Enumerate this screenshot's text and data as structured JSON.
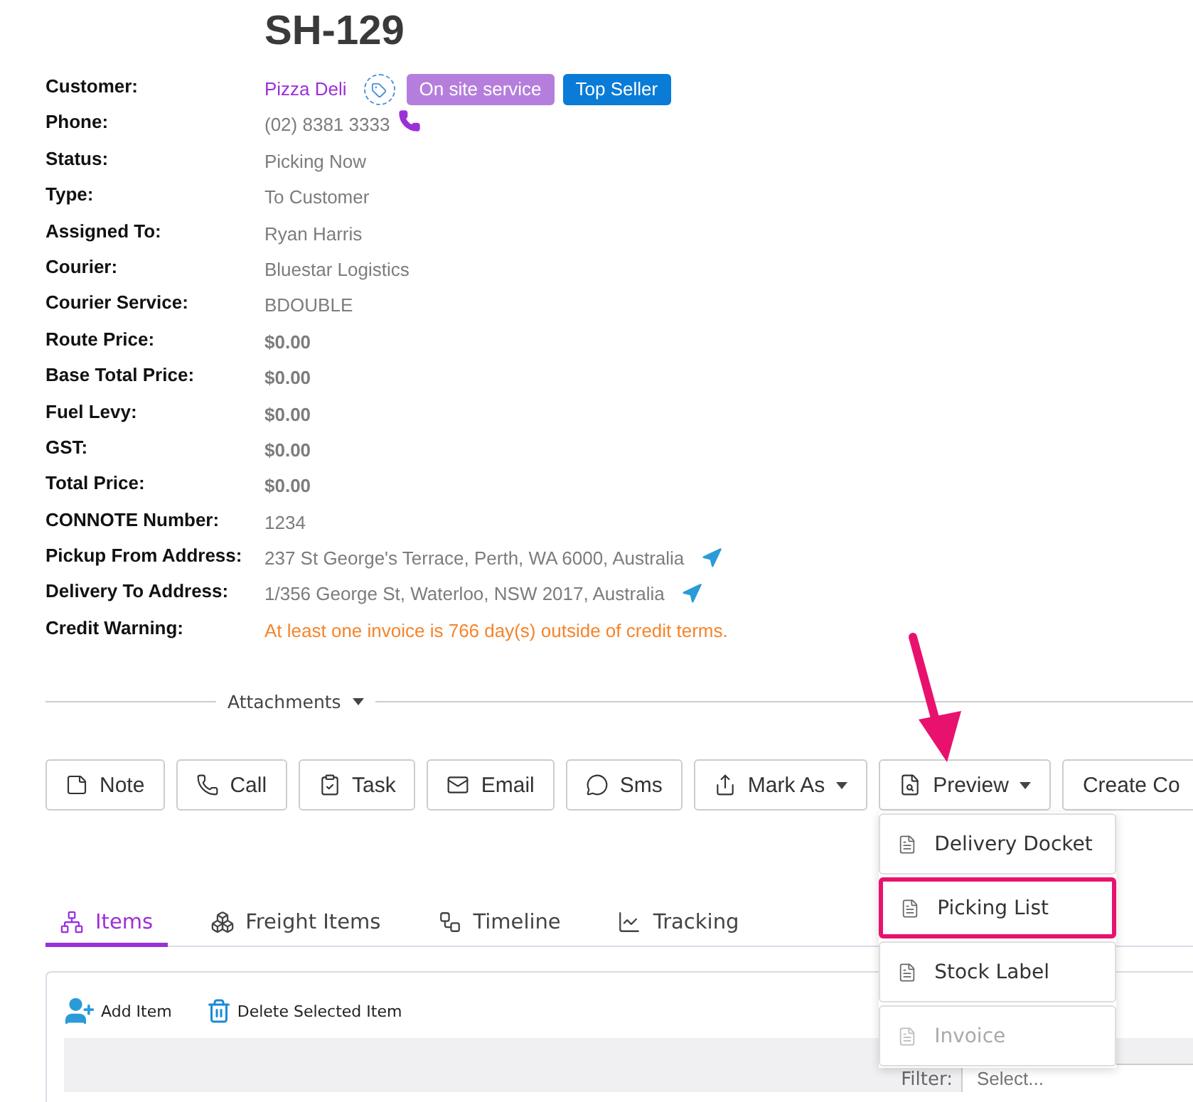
{
  "title": "SH-129",
  "fields": [
    {
      "label": "Customer:",
      "value": "Pizza Deli",
      "kind": "customer",
      "tags": [
        {
          "label": "On site service",
          "color": "#b57edc"
        },
        {
          "label": "Top Seller",
          "color": "#0a7bd6"
        }
      ]
    },
    {
      "label": "Phone:",
      "value": "(02) 8381 3333",
      "kind": "phone"
    },
    {
      "label": "Status:",
      "value": "Picking Now",
      "kind": "text"
    },
    {
      "label": "Type:",
      "value": "To Customer",
      "kind": "text"
    },
    {
      "label": "Assigned To:",
      "value": "Ryan Harris",
      "kind": "text"
    },
    {
      "label": "Courier:",
      "value": "Bluestar Logistics",
      "kind": "text"
    },
    {
      "label": "Courier Service:",
      "value": "BDOUBLE",
      "kind": "text"
    },
    {
      "label": "Route Price:",
      "value": "$0.00",
      "kind": "price"
    },
    {
      "label": "Base Total Price:",
      "value": "$0.00",
      "kind": "price"
    },
    {
      "label": "Fuel Levy:",
      "value": "$0.00",
      "kind": "price"
    },
    {
      "label": "GST:",
      "value": "$0.00",
      "kind": "price"
    },
    {
      "label": "Total Price:",
      "value": "$0.00",
      "kind": "price"
    },
    {
      "label": "CONNOTE Number:",
      "value": "1234",
      "kind": "text"
    },
    {
      "label": "Pickup From Address:",
      "value": "237 St George's Terrace, Perth, WA 6000, Australia",
      "kind": "address"
    },
    {
      "label": "Delivery To Address:",
      "value": "1/356 George St, Waterloo, NSW 2017, Australia",
      "kind": "address"
    },
    {
      "label": "Credit Warning:",
      "value": "At least one invoice is 766 day(s) outside of credit terms.",
      "kind": "warning"
    }
  ],
  "attachments": {
    "label": "Attachments"
  },
  "actions": [
    {
      "label": "Note",
      "kind": "note",
      "dropdown": false
    },
    {
      "label": "Call",
      "kind": "call",
      "dropdown": false
    },
    {
      "label": "Task",
      "kind": "task",
      "dropdown": false
    },
    {
      "label": "Email",
      "kind": "email",
      "dropdown": false
    },
    {
      "label": "Sms",
      "kind": "sms",
      "dropdown": false
    },
    {
      "label": "Mark As",
      "kind": "share",
      "dropdown": true
    },
    {
      "label": "Preview",
      "kind": "preview",
      "dropdown": true,
      "menu": [
        {
          "label": "Delivery Docket",
          "selected": false,
          "disabled": false
        },
        {
          "label": "Picking List",
          "selected": true,
          "disabled": false
        },
        {
          "label": "Stock Label",
          "selected": false,
          "disabled": false
        },
        {
          "label": "Invoice",
          "selected": false,
          "disabled": true
        }
      ]
    },
    {
      "label": "Create Co",
      "kind": "plain",
      "dropdown": false
    }
  ],
  "tabs": [
    {
      "label": "Items",
      "kind": "sitemap",
      "selected": true
    },
    {
      "label": "Freight Items",
      "kind": "boxes",
      "selected": false
    },
    {
      "label": "Timeline",
      "kind": "workflow",
      "selected": false
    },
    {
      "label": "Tracking",
      "kind": "chart",
      "selected": false
    }
  ],
  "toolbar": {
    "add": "Add Item",
    "delete": "Delete Selected Item"
  },
  "filter": {
    "label": "Filter:",
    "placeholder": "Select..."
  }
}
